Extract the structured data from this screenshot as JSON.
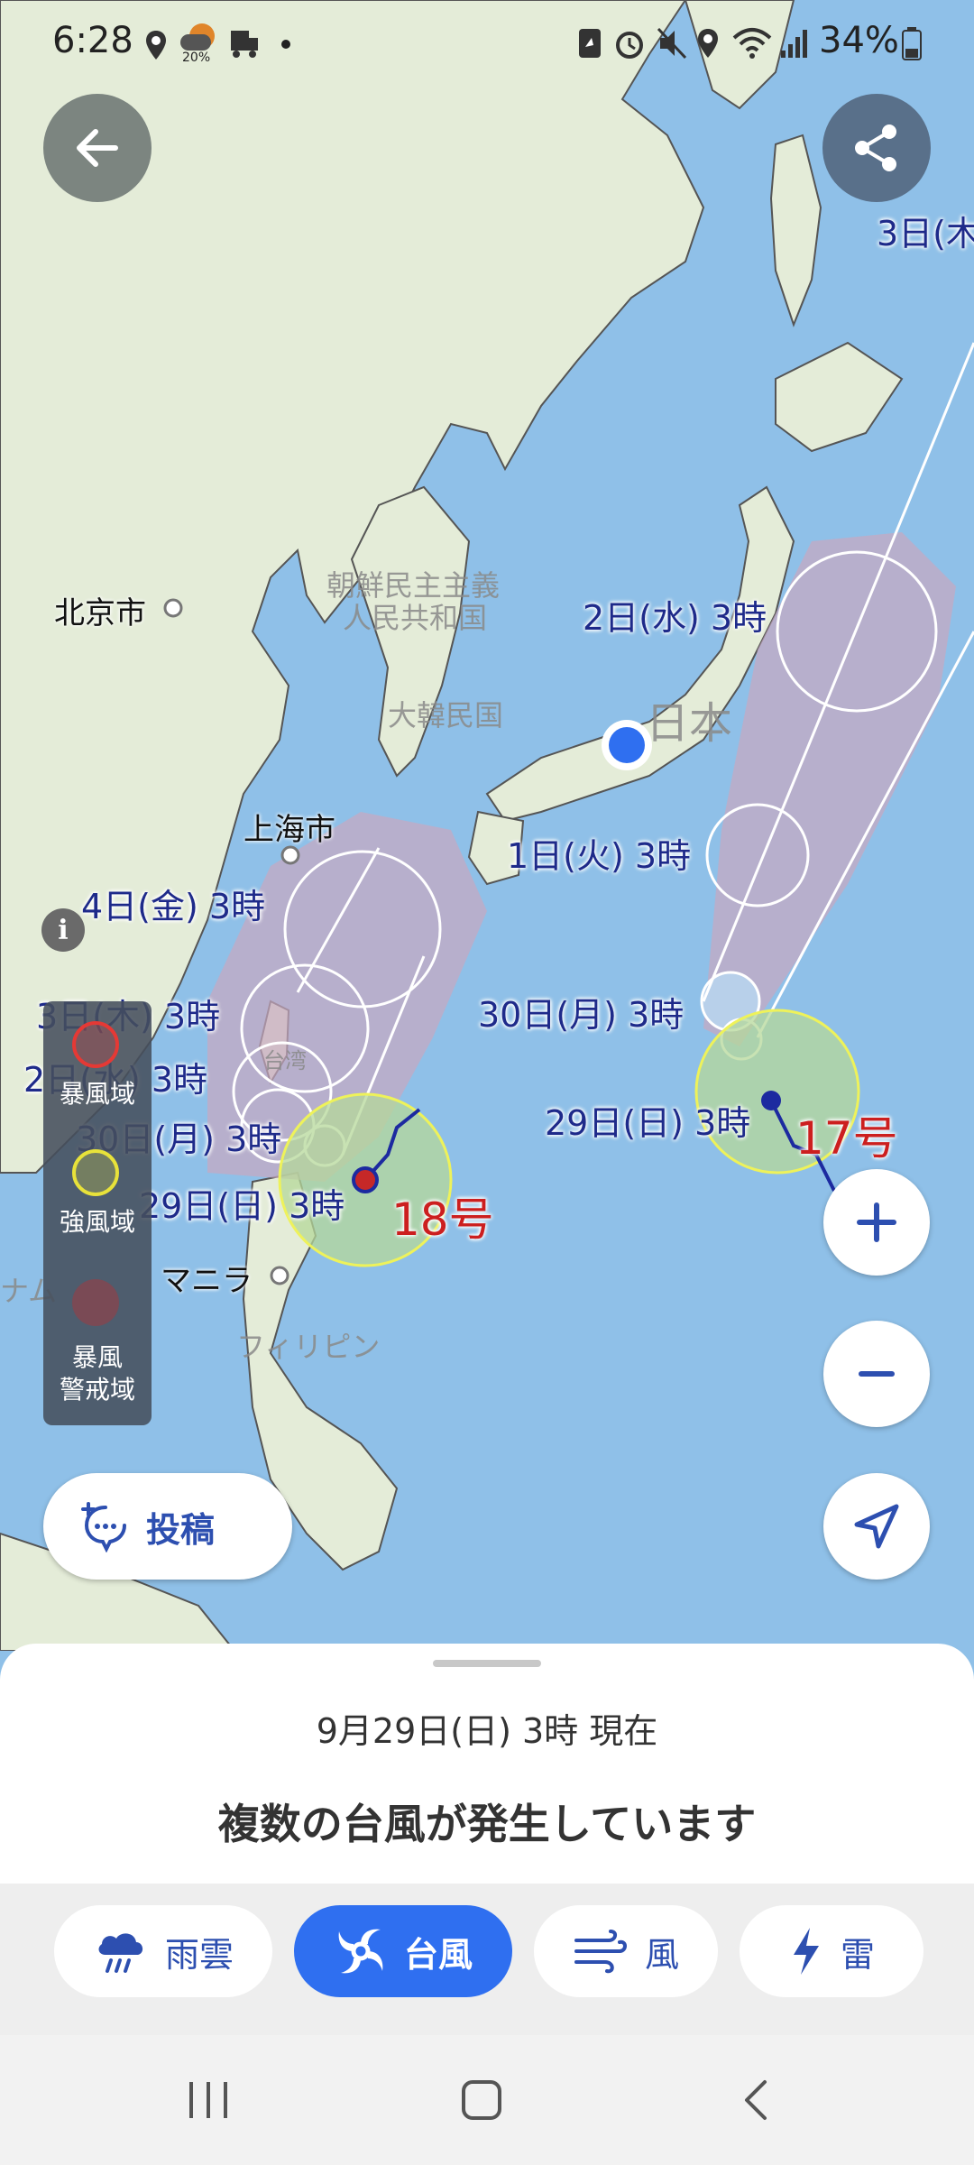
{
  "status_bar": {
    "time": "6:28",
    "weather_badge": "20%",
    "battery": "34%",
    "icons": [
      "location-icon",
      "weather-icon",
      "truck-icon",
      "dot-icon",
      "shield-icon",
      "alarm-icon",
      "mute-icon",
      "location-icon",
      "wifi-icon",
      "signal-icon",
      "battery-icon"
    ]
  },
  "map": {
    "forecast_labels": [
      {
        "text": "3日(木",
        "id": "forecast-17-d3"
      },
      {
        "text": "2日(水) 3時",
        "id": "forecast-17-d2"
      },
      {
        "text": "1日(火) 3時",
        "id": "forecast-17-d1"
      },
      {
        "text": "30日(月) 3時",
        "id": "forecast-17-d30"
      },
      {
        "text": "29日(日) 3時",
        "id": "forecast-17-d29"
      },
      {
        "text": "4日(金) 3時",
        "id": "forecast-18-d4"
      },
      {
        "text": "3日(木) 3時",
        "id": "forecast-18-d3"
      },
      {
        "text": "2日(水) 3時",
        "id": "forecast-18-d2"
      },
      {
        "text": "30日(月) 3時",
        "id": "forecast-18-d30"
      },
      {
        "text": "29日(日) 3時",
        "id": "forecast-18-d29"
      }
    ],
    "cities": {
      "beijing": "北京市",
      "shanghai": "上海市",
      "manila": "マニラ"
    },
    "countries": {
      "north_korea_1": "朝鮮民主主義",
      "north_korea_2": "人民共和国",
      "south_korea": "大韓民国",
      "japan": "日本",
      "philippines": "フィリピン",
      "taiwan": "台湾",
      "vietnam": "ナム"
    },
    "typhoons": {
      "t17": "17号",
      "t18": "18号"
    }
  },
  "legend": {
    "storm_area": "暴風域",
    "strong_wind_area": "強風域",
    "storm_warning_1": "暴風",
    "storm_warning_2": "警戒域"
  },
  "post_button": {
    "label": "投稿"
  },
  "sheet": {
    "time": "9月29日(日) 3時 現在",
    "headline": "複数の台風が発生しています"
  },
  "tabs": [
    {
      "label": "雨雲",
      "icon": "rain-cloud-icon",
      "active": false
    },
    {
      "label": "台風",
      "icon": "typhoon-icon",
      "active": true
    },
    {
      "label": "風",
      "icon": "wind-icon",
      "active": false
    },
    {
      "label": "雷",
      "icon": "lightning-icon",
      "active": false
    }
  ],
  "colors": {
    "sea": "#8fc0e8",
    "land": "#e4ecd8",
    "accent": "#2f6ff0",
    "typhoon_label": "#cc1f1f",
    "forecast_label": "#1e2a8a"
  }
}
